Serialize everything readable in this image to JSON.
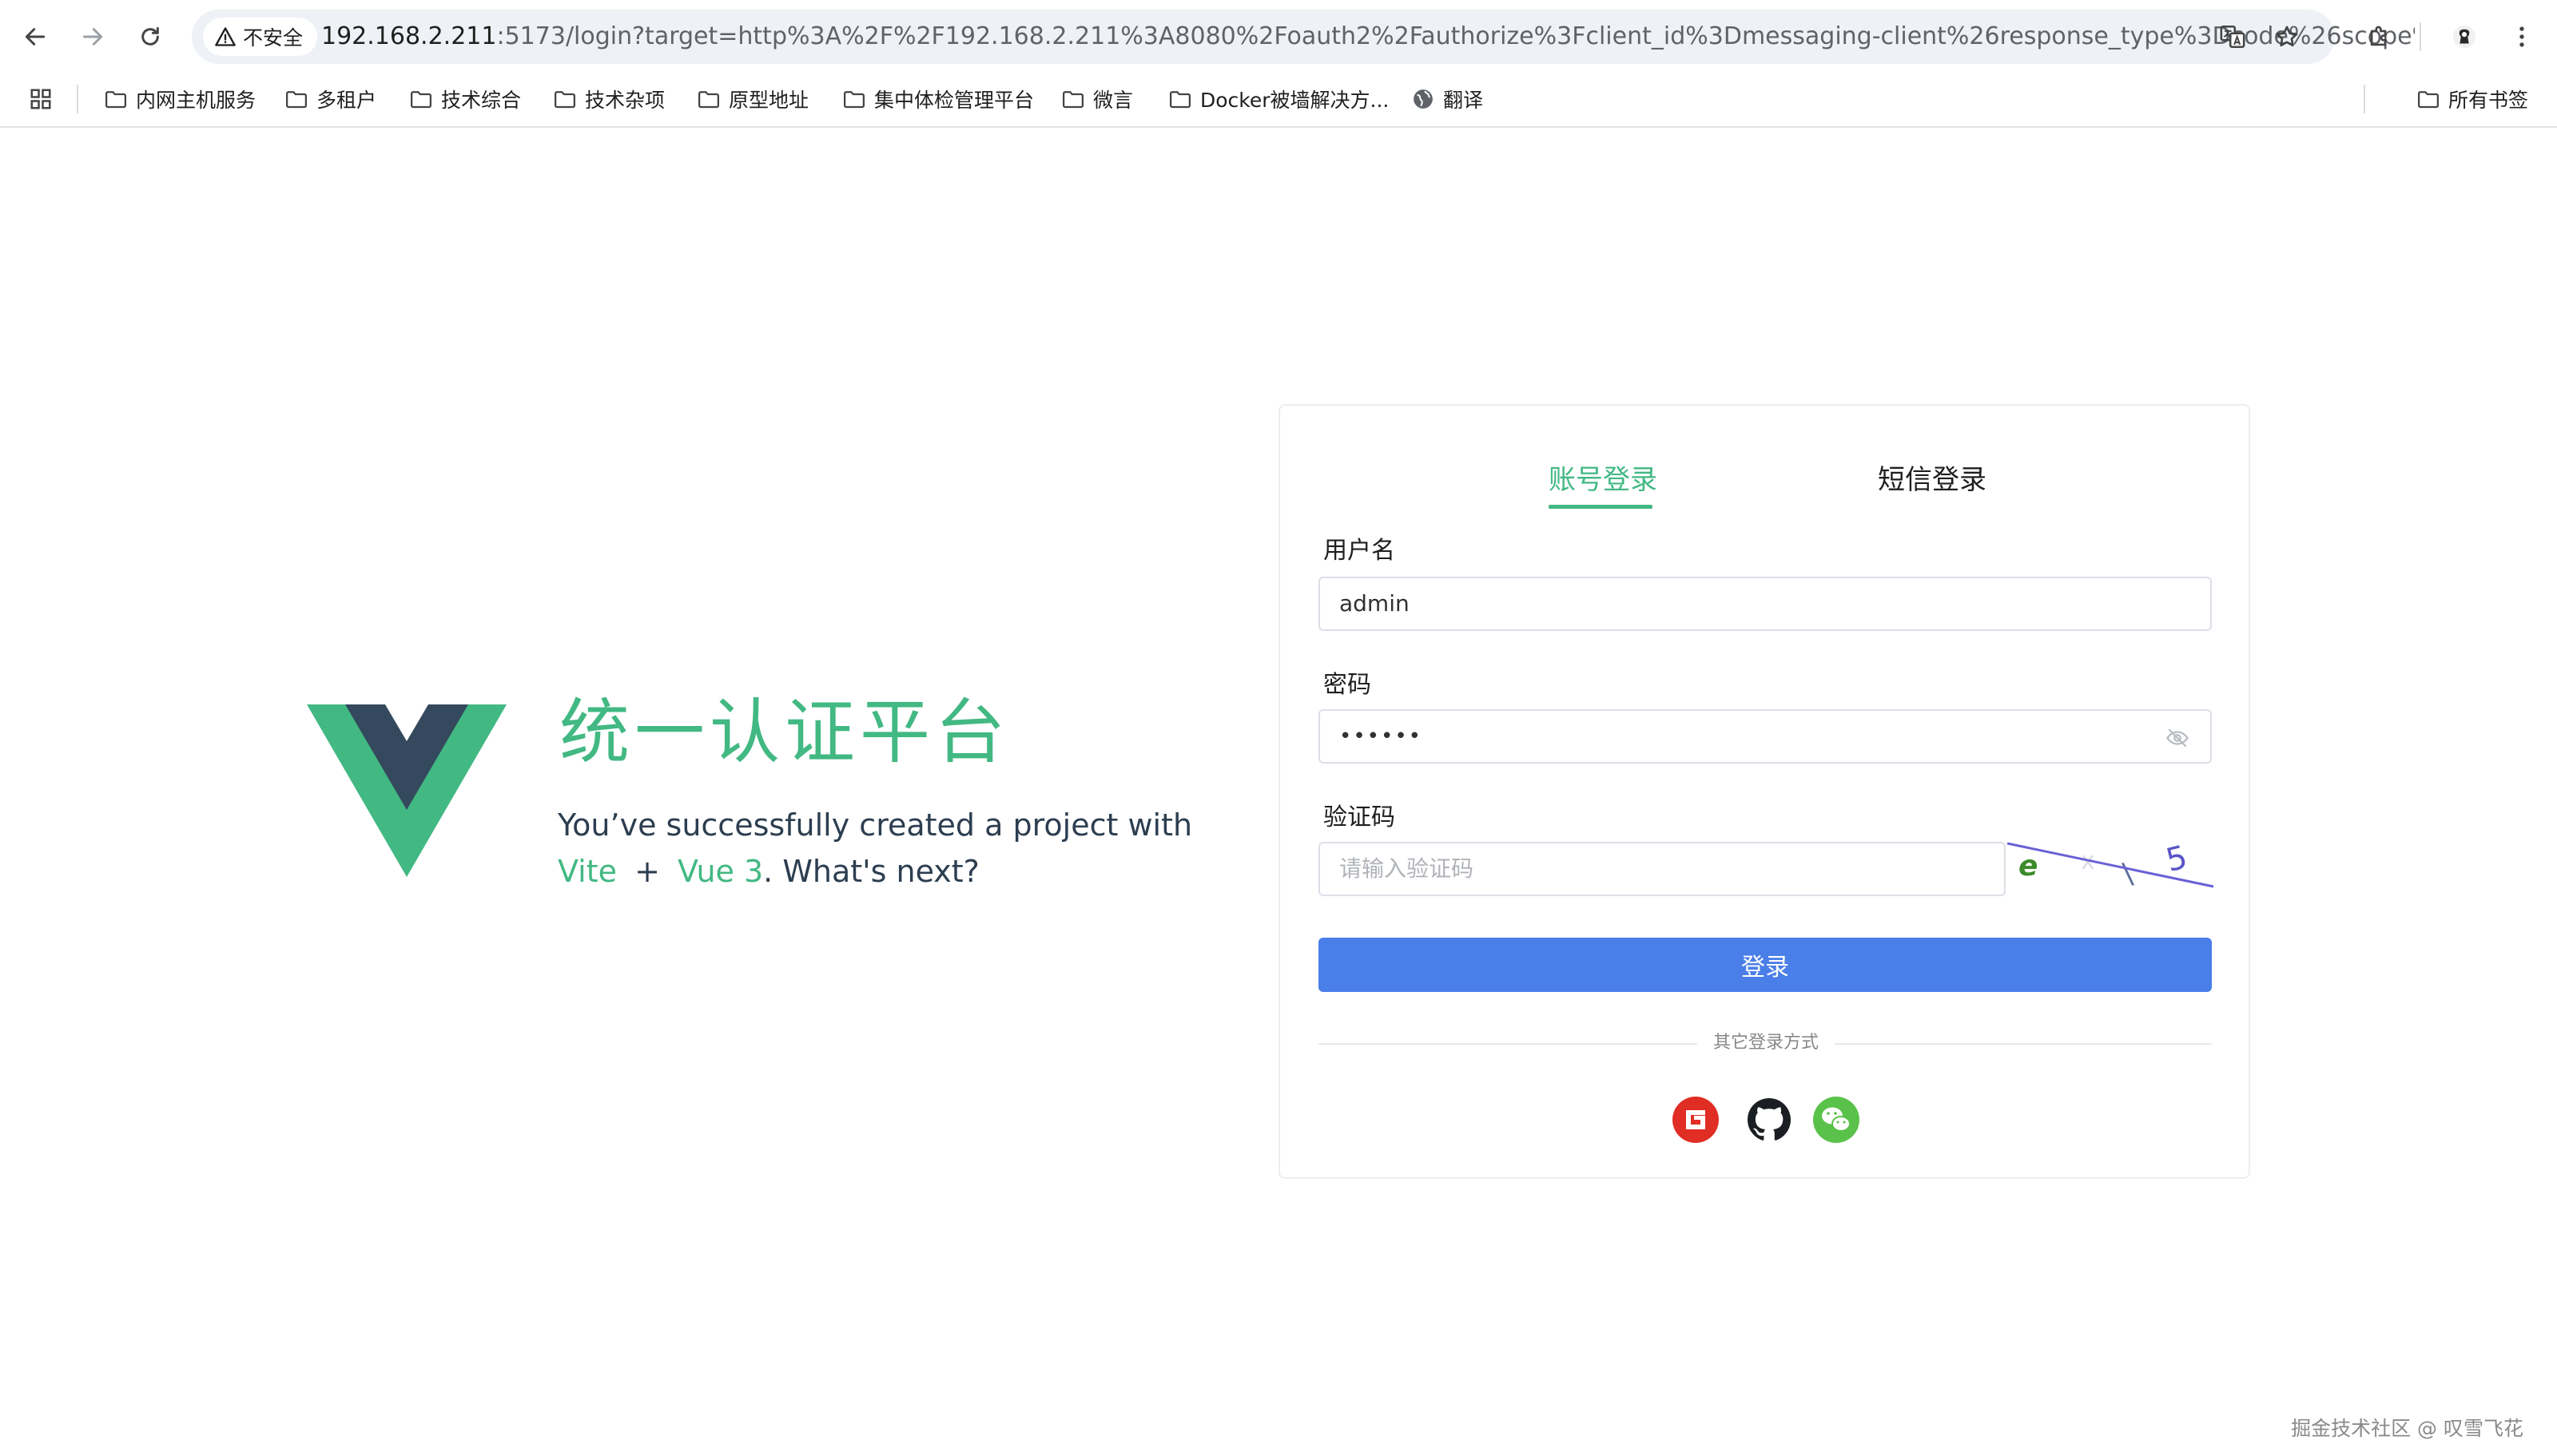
{
  "browser": {
    "security_label": "不安全",
    "url_host": "192.168.2.211",
    "url_rest": ":5173/login?target=http%3A%2F%2F192.168.2.211%3A8080%2Foauth2%2Fauthorize%3Fclient_id%3Dmessaging-client%26response_type%3Dcode%26scope%3..."
  },
  "bookmarks": {
    "items": [
      {
        "label": "内网主机服务",
        "icon": "folder-icon"
      },
      {
        "label": "多租户",
        "icon": "folder-icon"
      },
      {
        "label": "技术综合",
        "icon": "folder-icon"
      },
      {
        "label": "技术杂项",
        "icon": "folder-icon"
      },
      {
        "label": "原型地址",
        "icon": "folder-icon"
      },
      {
        "label": "集中体检管理平台",
        "icon": "folder-icon"
      },
      {
        "label": "微言",
        "icon": "folder-icon"
      },
      {
        "label": "Docker被墙解决方...",
        "icon": "folder-icon"
      },
      {
        "label": "翻译",
        "icon": "globe-icon"
      }
    ],
    "all_bookmarks": "所有书签"
  },
  "hero": {
    "title": "统一认证平台",
    "subtitle_line1": "You’ve successfully created a project with",
    "link_vite": "Vite",
    "plus": "+",
    "link_vue": "Vue 3",
    "subtitle_end": ". What's next?"
  },
  "login": {
    "tab_account": "账号登录",
    "tab_sms": "短信登录",
    "username_label": "用户名",
    "username_value": "admin",
    "password_label": "密码",
    "password_value": "••••••",
    "captcha_label": "验证码",
    "captcha_placeholder": "请输入验证码",
    "captcha_text": [
      "e",
      "x",
      "\\",
      "5"
    ],
    "submit": "登录",
    "other_methods": "其它登录方式"
  },
  "footer": "掘金技术社区 @ 叹雪飞花",
  "colors": {
    "accent_green": "#42b883",
    "vue_dark": "#35495e",
    "button_blue": "#4a7ee8",
    "gitee_red": "#e02e24",
    "wechat_green": "#5ac24a"
  }
}
